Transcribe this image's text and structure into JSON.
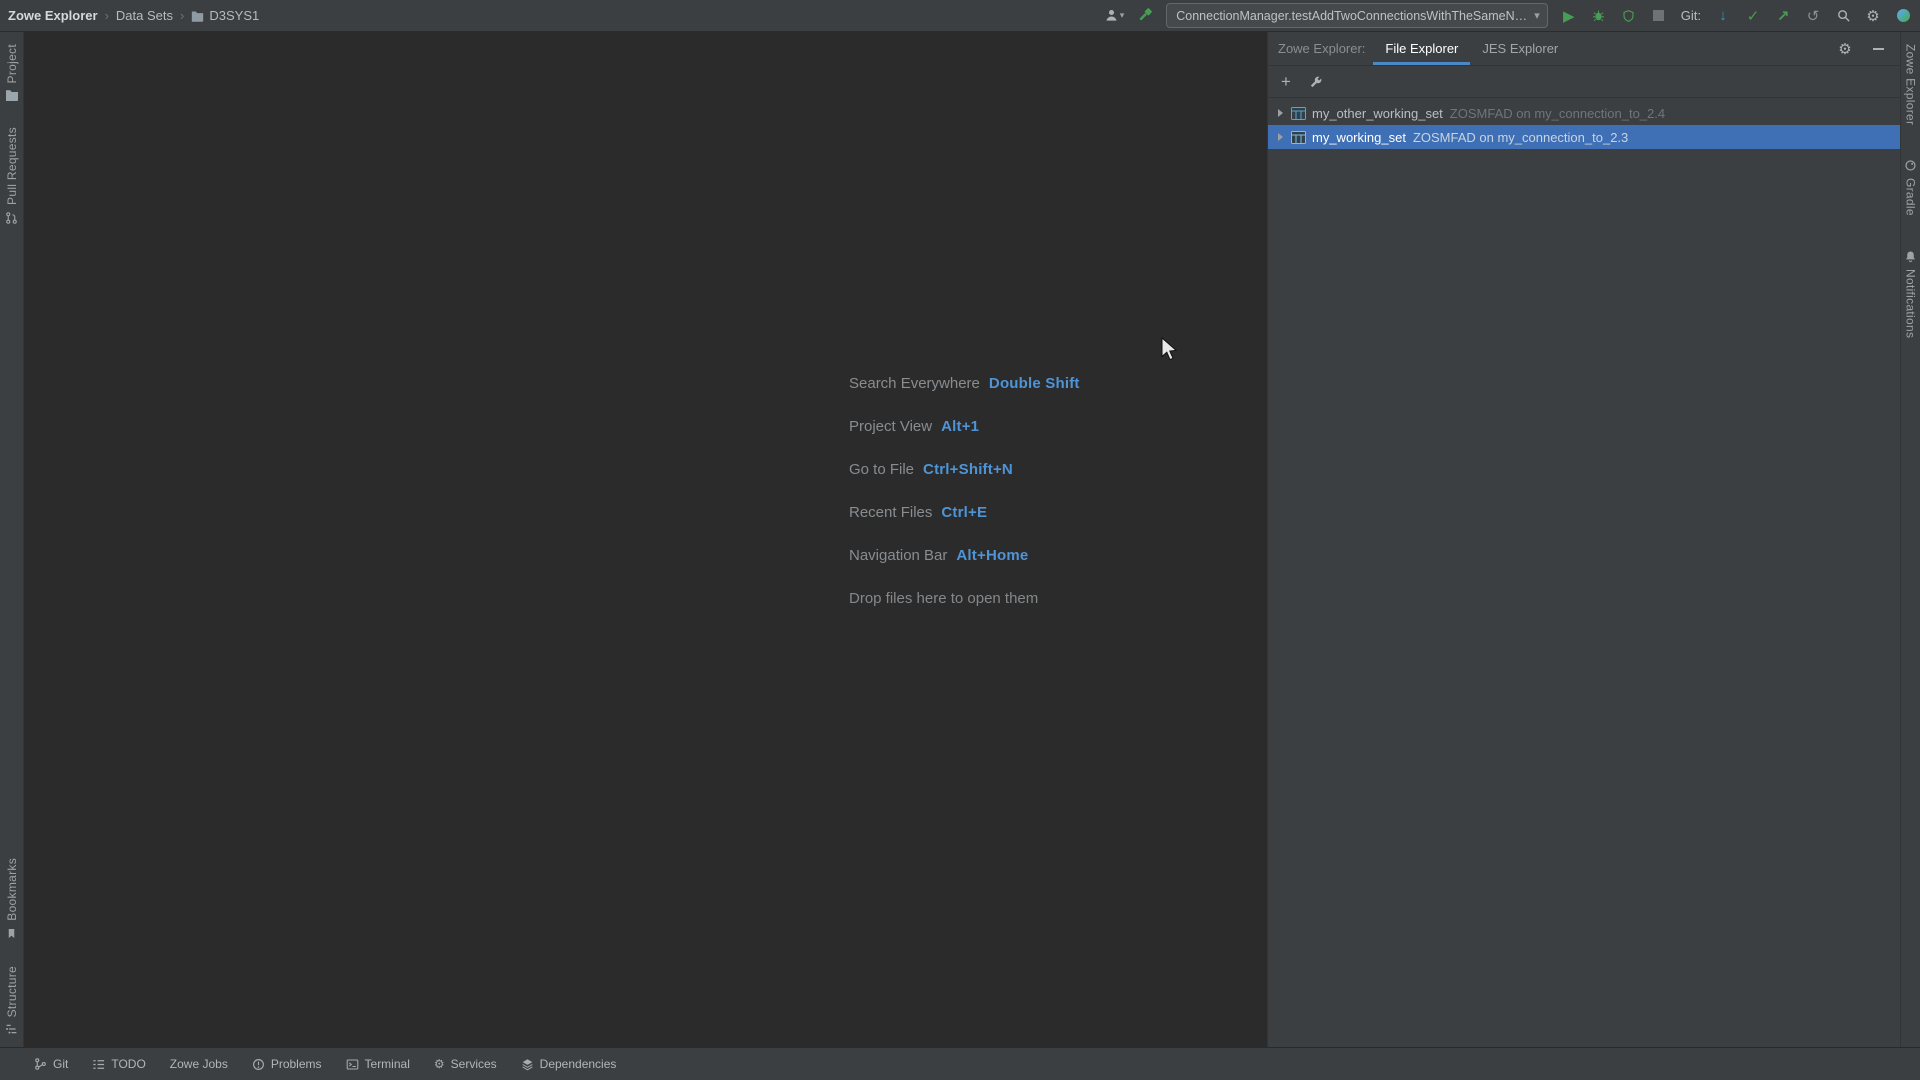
{
  "colors": {
    "panel_bg": "#3c3f41",
    "editor_bg": "#2b2b2b",
    "selection_blue": "#3f6fb5",
    "tab_underline_blue": "#4a88c7",
    "shortcut_key_blue": "#4f94d6",
    "run_green": "#499c54",
    "vcs_update_blue": "#3592c4"
  },
  "icons": {
    "breadcrumb_separator": "›",
    "dropdown_arrow": "▾",
    "run_glyph": "▶",
    "git_update_glyph": "↓",
    "git_commit_glyph": "✓",
    "git_push_glyph": "↗",
    "revert_glyph": "↺",
    "gear_glyph": "⚙",
    "add_glyph": "+"
  },
  "topbar": {
    "breadcrumb": [
      {
        "label": "Zowe Explorer"
      },
      {
        "label": "Data Sets"
      },
      {
        "label": "D3SYS1"
      }
    ],
    "run_config": "ConnectionManager.testAddTwoConnectionsWithTheSameName",
    "git_label": "Git:"
  },
  "left_stripe": {
    "project": "Project",
    "pull_requests": "Pull Requests",
    "bookmarks": "Bookmarks",
    "structure": "Structure"
  },
  "right_stripe": {
    "zowe_explorer": "Zowe Explorer",
    "gradle": "Gradle",
    "notifications": "Notifications"
  },
  "editor": {
    "shortcuts": [
      {
        "label": "Search Everywhere",
        "keys": "Double Shift"
      },
      {
        "label": "Project View",
        "keys": "Alt+1"
      },
      {
        "label": "Go to File",
        "keys": "Ctrl+Shift+N"
      },
      {
        "label": "Recent Files",
        "keys": "Ctrl+E"
      },
      {
        "label": "Navigation Bar",
        "keys": "Alt+Home"
      }
    ],
    "drop_hint": "Drop files here to open them"
  },
  "zowe_panel": {
    "title": "Zowe Explorer:",
    "tabs": [
      {
        "label": "File Explorer",
        "active": true
      },
      {
        "label": "JES Explorer",
        "active": false
      }
    ],
    "tree": [
      {
        "name": "my_other_working_set",
        "detail": "ZOSMFAD on my_connection_to_2.4",
        "selected": false
      },
      {
        "name": "my_working_set",
        "detail": "ZOSMFAD on my_connection_to_2.3",
        "selected": true
      }
    ]
  },
  "status_bar": {
    "items": [
      {
        "label": "Git"
      },
      {
        "label": "TODO"
      },
      {
        "label": "Zowe Jobs"
      },
      {
        "label": "Problems"
      },
      {
        "label": "Terminal"
      },
      {
        "label": "Services"
      },
      {
        "label": "Dependencies"
      }
    ]
  }
}
